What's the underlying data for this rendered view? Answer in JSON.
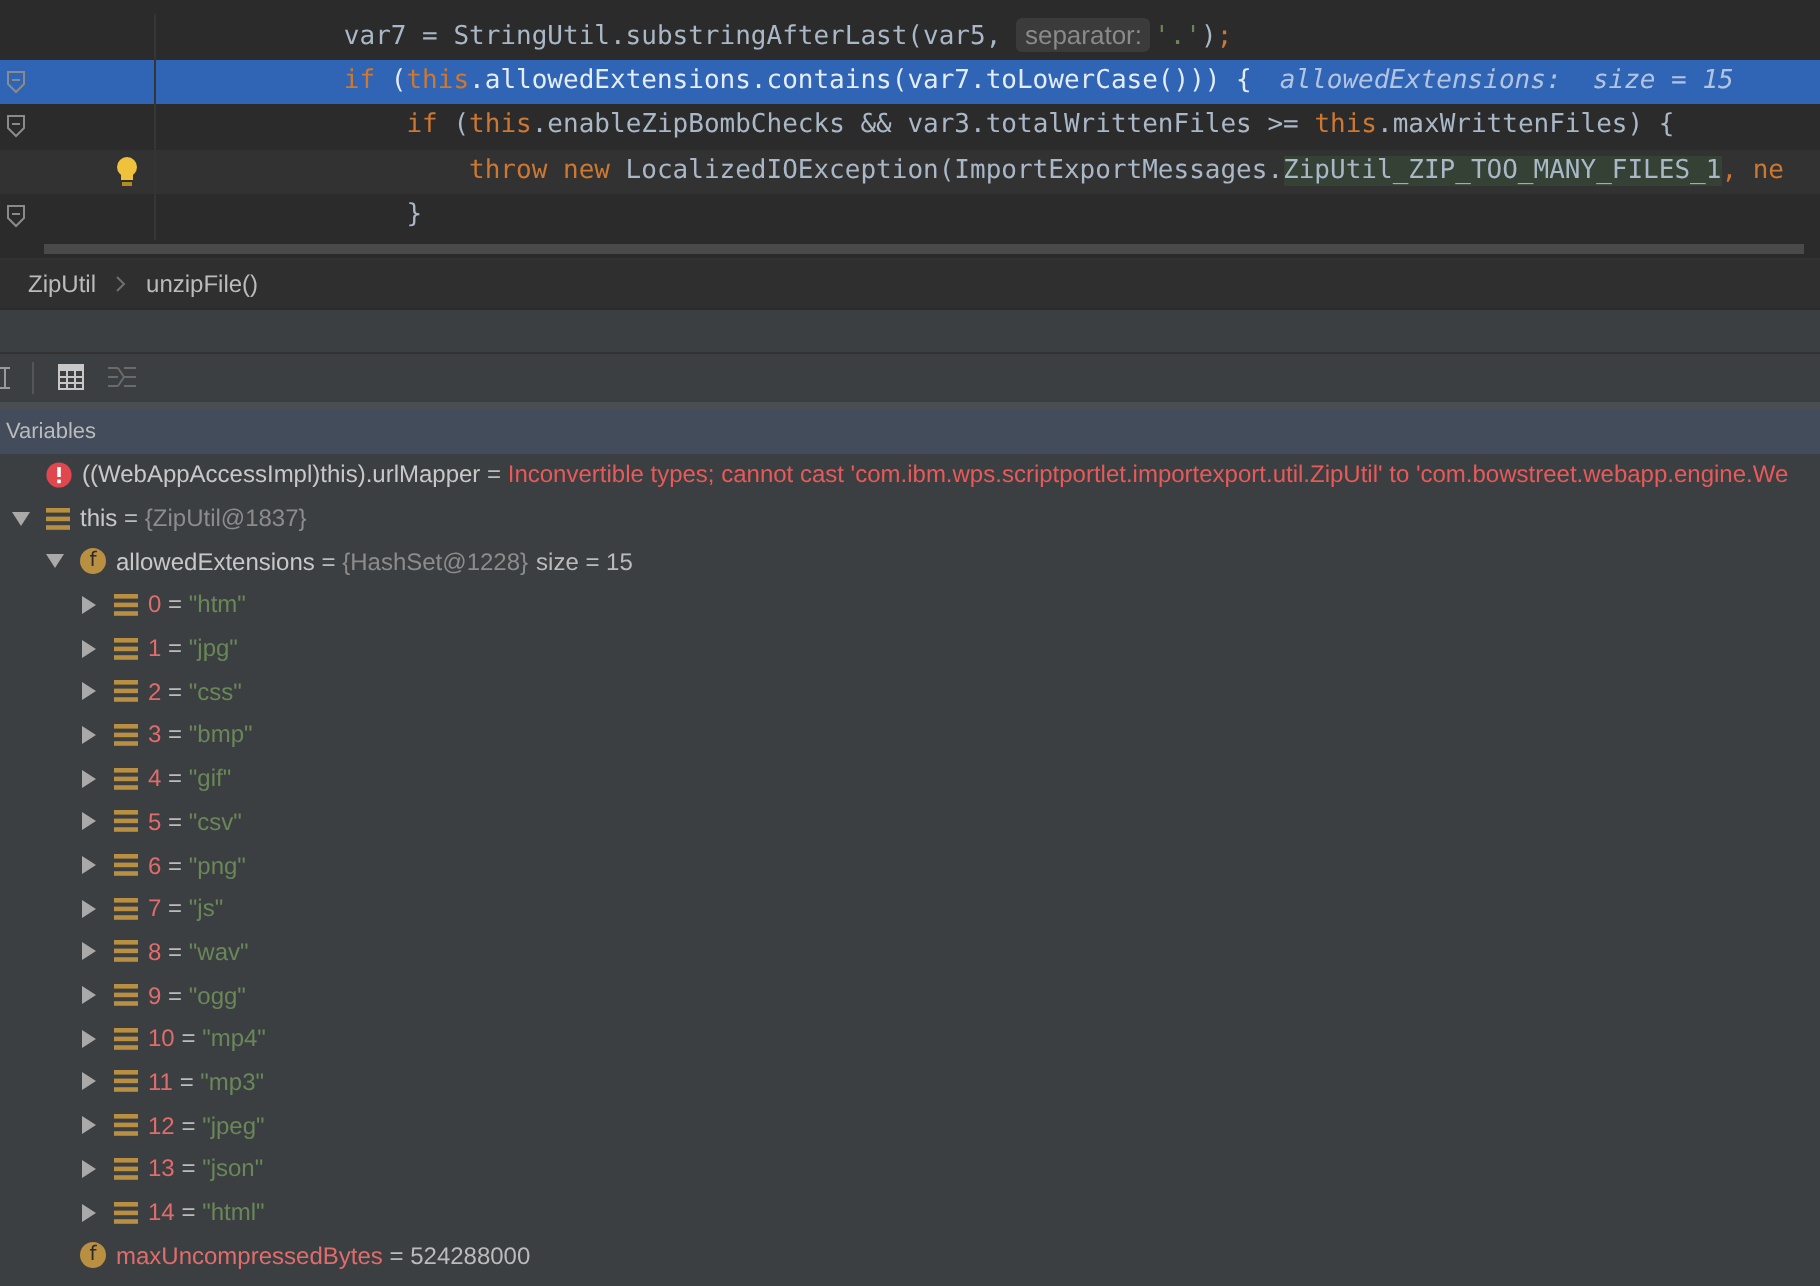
{
  "editor": {
    "lines": [
      {
        "selected": false,
        "bulb": false,
        "fold": false,
        "tokens": [
          {
            "kind": "plain",
            "text": "            var7 = StringUtil.substringAfterLast(var5, "
          },
          {
            "kind": "hint",
            "text": "separator:"
          },
          {
            "kind": "string",
            "text": "'.'"
          },
          {
            "kind": "plain",
            "text": ")"
          },
          {
            "kind": "keyword",
            "text": ";"
          }
        ]
      },
      {
        "selected": true,
        "bulb": false,
        "fold": true,
        "tokens": [
          {
            "kind": "keyword",
            "text": "            if"
          },
          {
            "kind": "plain",
            "text": " ("
          },
          {
            "kind": "keyword",
            "text": "this"
          },
          {
            "kind": "plain",
            "text": ".allowedExtensions.contains(var7.toLowerCase())) {"
          },
          {
            "kind": "value-hint",
            "text": "allowedExtensions:  size = 15"
          }
        ]
      },
      {
        "selected": false,
        "bulb": false,
        "fold": true,
        "tokens": [
          {
            "kind": "keyword",
            "text": "                if"
          },
          {
            "kind": "plain",
            "text": " ("
          },
          {
            "kind": "keyword",
            "text": "this"
          },
          {
            "kind": "plain",
            "text": ".enableZipBombChecks && var3.totalWrittenFiles >= "
          },
          {
            "kind": "keyword",
            "text": "this"
          },
          {
            "kind": "plain",
            "text": ".maxWrittenFiles) {"
          }
        ]
      },
      {
        "selected": false,
        "bulb": true,
        "fold": false,
        "tokens": [
          {
            "kind": "keyword",
            "text": "                    throw new"
          },
          {
            "kind": "plain",
            "text": " LocalizedIOException(ImportExportMessages."
          },
          {
            "kind": "highlight",
            "text": "ZipUtil_ZIP_TOO_MANY_FILES_1"
          },
          {
            "kind": "keyword",
            "text": ", ne"
          }
        ]
      },
      {
        "selected": false,
        "bulb": false,
        "fold": true,
        "tokens": [
          {
            "kind": "plain",
            "text": "                }"
          }
        ]
      }
    ]
  },
  "breadcrumb": [
    "ZipUtil",
    "unzipFile()"
  ],
  "variables_panel": {
    "title": "Variables",
    "nodes": [
      {
        "kind": "error",
        "name": "((WebAppAccessImpl)this).urlMapper",
        "eq": "=",
        "value": "Inconvertible types; cannot cast 'com.ibm.wps.scriptportlet.importexport.util.ZipUtil' to 'com.bowstreet.webapp.engine.We",
        "changed": false
      },
      {
        "kind": "object",
        "name": "this",
        "eq": "=",
        "value": "{ZipUtil@1837}",
        "changed": false,
        "expanded": true,
        "children": [
          {
            "kind": "object",
            "badge": "f",
            "name": "allowedExtensions",
            "eq": "=",
            "value": "{HashSet@1228}",
            "extra": "size = 15",
            "changed": false,
            "expanded": true,
            "children": [
              {
                "kind": "string",
                "name": "0",
                "eq": "=",
                "value": "\"htm\"",
                "changed": true,
                "expanded": false
              },
              {
                "kind": "string",
                "name": "1",
                "eq": "=",
                "value": "\"jpg\"",
                "changed": true,
                "expanded": false
              },
              {
                "kind": "string",
                "name": "2",
                "eq": "=",
                "value": "\"css\"",
                "changed": true,
                "expanded": false
              },
              {
                "kind": "string",
                "name": "3",
                "eq": "=",
                "value": "\"bmp\"",
                "changed": true,
                "expanded": false
              },
              {
                "kind": "string",
                "name": "4",
                "eq": "=",
                "value": "\"gif\"",
                "changed": true,
                "expanded": false
              },
              {
                "kind": "string",
                "name": "5",
                "eq": "=",
                "value": "\"csv\"",
                "changed": true,
                "expanded": false
              },
              {
                "kind": "string",
                "name": "6",
                "eq": "=",
                "value": "\"png\"",
                "changed": true,
                "expanded": false
              },
              {
                "kind": "string",
                "name": "7",
                "eq": "=",
                "value": "\"js\"",
                "changed": true,
                "expanded": false
              },
              {
                "kind": "string",
                "name": "8",
                "eq": "=",
                "value": "\"wav\"",
                "changed": true,
                "expanded": false
              },
              {
                "kind": "string",
                "name": "9",
                "eq": "=",
                "value": "\"ogg\"",
                "changed": true,
                "expanded": false
              },
              {
                "kind": "string",
                "name": "10",
                "eq": "=",
                "value": "\"mp4\"",
                "changed": true,
                "expanded": false
              },
              {
                "kind": "string",
                "name": "11",
                "eq": "=",
                "value": "\"mp3\"",
                "changed": true,
                "expanded": false
              },
              {
                "kind": "string",
                "name": "12",
                "eq": "=",
                "value": "\"jpeg\"",
                "changed": true,
                "expanded": false
              },
              {
                "kind": "string",
                "name": "13",
                "eq": "=",
                "value": "\"json\"",
                "changed": true,
                "expanded": false
              },
              {
                "kind": "string",
                "name": "14",
                "eq": "=",
                "value": "\"html\"",
                "changed": true,
                "expanded": false
              }
            ]
          },
          {
            "kind": "number",
            "badge": "f",
            "name": "maxUncompressedBytes",
            "eq": "=",
            "value": "524288000",
            "changed": true
          }
        ]
      }
    ]
  }
}
